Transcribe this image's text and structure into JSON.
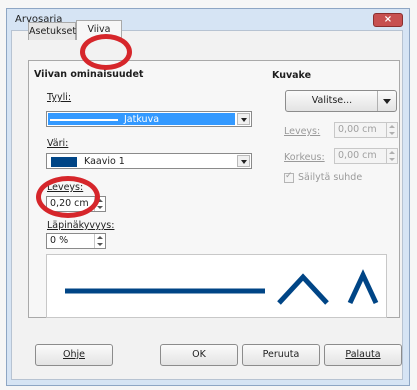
{
  "dialog": {
    "title": "Arvosarja",
    "close_symbol": "×"
  },
  "tabs": [
    {
      "label": "Asetukset"
    },
    {
      "label": "Viiva"
    }
  ],
  "line_properties": {
    "heading": "Viivan ominaisuudet",
    "style_label": "Tyyli:",
    "style_value": "Jatkuva",
    "color_label": "Väri:",
    "color_value": "Kaavio 1",
    "width_label": "Leveys:",
    "width_value": "0,20 cm",
    "transparency_label": "Läpinäkyvyys:",
    "transparency_value": "0 %"
  },
  "icon_section": {
    "heading": "Kuvake",
    "select_button": "Valitse...",
    "width_label": "Leveys:",
    "width_value": "0,00 cm",
    "height_label": "Korkeus:",
    "height_value": "0,00 cm",
    "keep_ratio_label": "Säilytä suhde"
  },
  "footer": {
    "help": "Ohje",
    "ok": "OK",
    "cancel": "Peruuta",
    "reset": "Palauta"
  },
  "colors": {
    "accent_selection": "#3399ff",
    "line_color": "#004586",
    "annotation_red": "#d6262b"
  }
}
